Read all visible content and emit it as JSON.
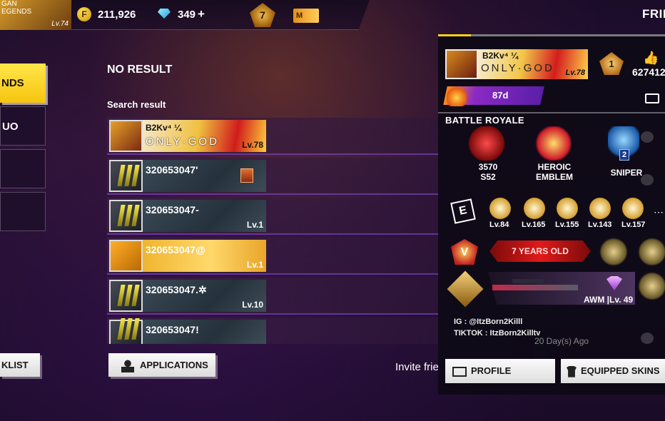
{
  "header": {
    "player_name_lines": [
      "GAN",
      "EGENDS"
    ],
    "player_level": "Lv.74",
    "gold_icon": "F",
    "gold": "211,926",
    "diamonds": "349",
    "add_label": "+",
    "rank_level": "7",
    "membership": "M",
    "title_partial": "FRIE"
  },
  "tabs": [
    {
      "label": "NDS",
      "active": true
    },
    {
      "label": "UO",
      "active": false
    },
    {
      "label": "",
      "active": false
    },
    {
      "label": "",
      "active": false
    }
  ],
  "search": {
    "status": "NO RESULT",
    "result_label": "Search result"
  },
  "results": [
    {
      "name": "B2Kv⁴  ¼",
      "subtitle": "ONLY·GOD",
      "level": "Lv.78",
      "style": "red"
    },
    {
      "name": "320653047'",
      "level": "",
      "style": "dark"
    },
    {
      "name": "320653047-",
      "level": "Lv.1",
      "style": "dark"
    },
    {
      "name": "320653047@",
      "level": "Lv.1",
      "style": "gold"
    },
    {
      "name": "320653047.✲",
      "level": "Lv.10",
      "style": "dark"
    },
    {
      "name": "320653047!",
      "level": "",
      "style": "dark"
    }
  ],
  "buttons": {
    "blacklist": "KLIST",
    "applications": "APPLICATIONS",
    "invite": "Invite frie"
  },
  "profile": {
    "name": "B2Kv⁴  ¼",
    "banner_text": "ONLY·GOD",
    "level": "Lv.78",
    "rank": "1",
    "likes": "627412",
    "days": "87d",
    "section": "BATTLE ROYALE",
    "stats": [
      {
        "line1": "3570",
        "line2": "S52"
      },
      {
        "line1": "HEROIC",
        "line2": "EMBLEM"
      },
      {
        "line1": "SNIPER",
        "line2": ""
      }
    ],
    "sniper_rank": "2",
    "badges": [
      "Lv.84",
      "Lv.165",
      "Lv.155",
      "Lv.143",
      "Lv.157"
    ],
    "years_text": "7 YEARS OLD",
    "weapon": "AWM",
    "weapon_level": "Lv. 49",
    "ig": "IG : @ItzBorn2Killl",
    "tiktok": "TIKTOK : ItzBorn2Killtv",
    "last_seen": "20 Day(s) Ago",
    "profile_button": "PROFILE",
    "skins_button": "EQUIPPED SKINS",
    "badge_letter": "E",
    "emblem_letter": "V"
  }
}
